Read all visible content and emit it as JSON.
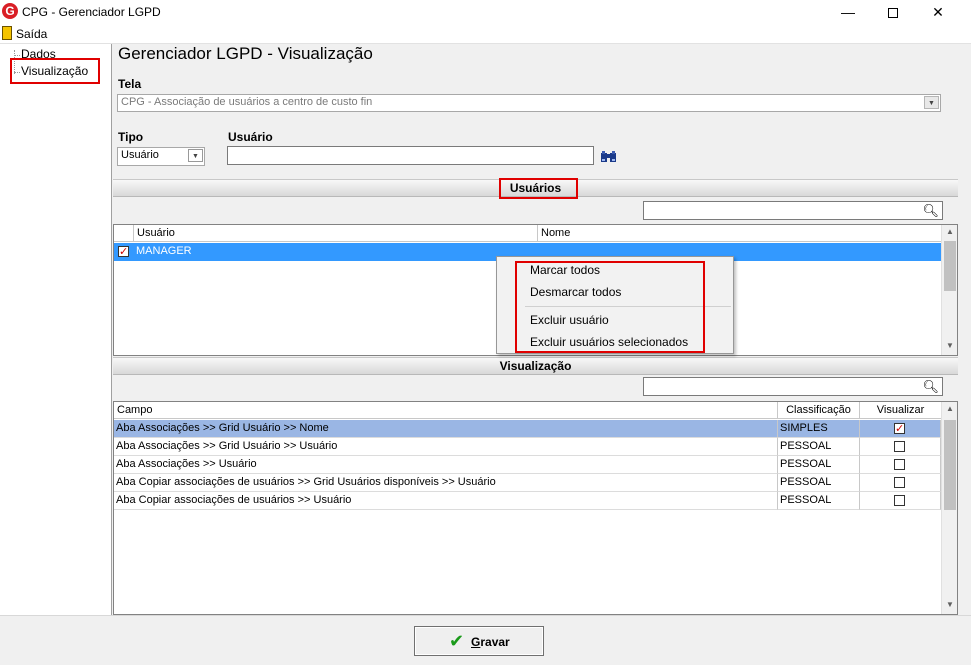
{
  "window": {
    "title": "CPG - Gerenciador LGPD",
    "minimize": "—",
    "close": "✕"
  },
  "menu": {
    "exit_label": "Saída"
  },
  "tree": {
    "items": [
      "Dados",
      "Visualização"
    ]
  },
  "main": {
    "title": "Gerenciador LGPD - Visualização",
    "tela_label": "Tela",
    "tela_value": "CPG - Associação de usuários a centro de custo fin",
    "tipo_label": "Tipo",
    "tipo_value": "Usuário",
    "usuario_label": "Usuário",
    "usuario_value": ""
  },
  "users_section": {
    "title": "Usuários",
    "search_value": "",
    "columns": [
      "Usuário",
      "Nome"
    ],
    "rows": [
      {
        "checked": true,
        "usuario": "MANAGER",
        "nome": ""
      }
    ]
  },
  "context_menu": {
    "items": [
      "Marcar todos",
      "Desmarcar todos",
      "Excluir usuário",
      "Excluir usuários selecionados"
    ]
  },
  "view_section": {
    "title": "Visualização",
    "search_value": "",
    "columns": [
      "Campo",
      "Classificação",
      "Visualizar"
    ],
    "rows": [
      {
        "campo": "Aba Associações >> Grid Usuário >> Nome",
        "classificacao": "SIMPLES",
        "visualizar": true
      },
      {
        "campo": "Aba Associações >> Grid Usuário >> Usuário",
        "classificacao": "PESSOAL",
        "visualizar": false
      },
      {
        "campo": "Aba Associações >> Usuário",
        "classificacao": "PESSOAL",
        "visualizar": false
      },
      {
        "campo": "Aba Copiar associações de usuários >> Grid Usuários disponíveis >> Usuário",
        "classificacao": "PESSOAL",
        "visualizar": false
      },
      {
        "campo": "Aba Copiar associações de usuários >> Usuário",
        "classificacao": "PESSOAL",
        "visualizar": false
      }
    ]
  },
  "footer": {
    "save_first": "G",
    "save_rest": "ravar"
  },
  "colors": {
    "selection": "#3399ff",
    "highlight_row": "#9ab6e4",
    "annotation": "#e00000",
    "save_check": "#1a9a1a"
  }
}
